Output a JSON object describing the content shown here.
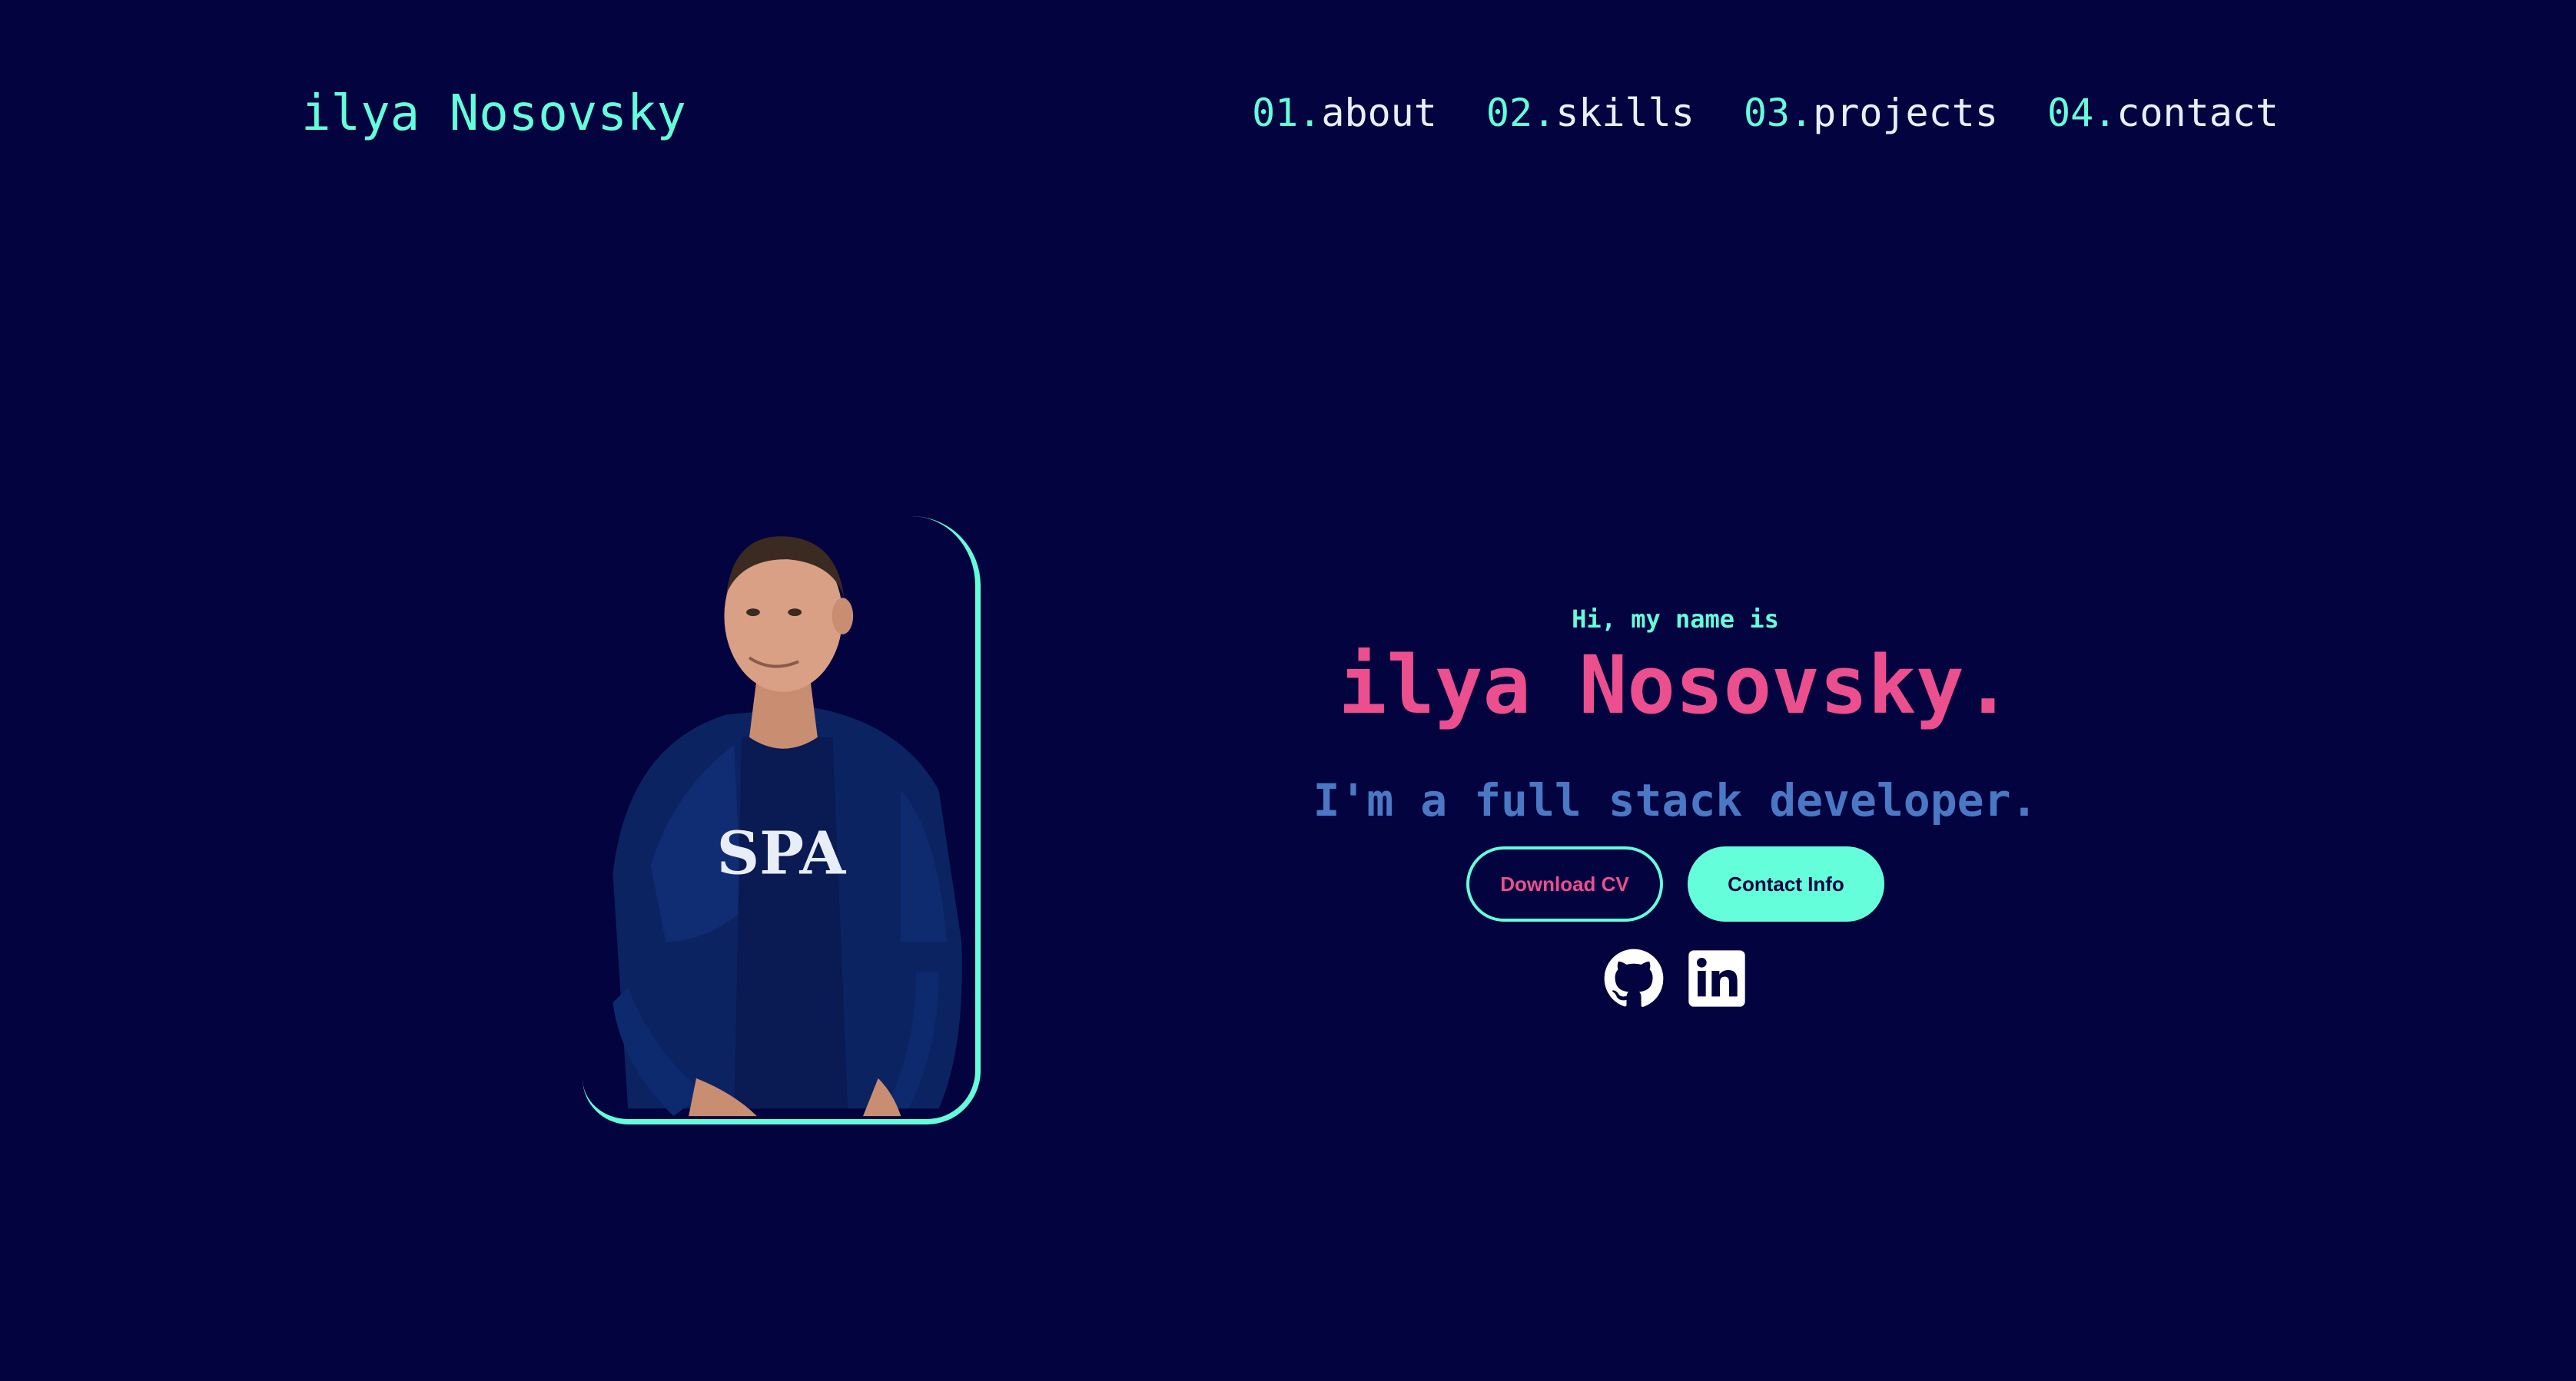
{
  "header": {
    "logo_text": "ilya Nosovsky",
    "nav": [
      {
        "number": "01.",
        "label": "about"
      },
      {
        "number": "02.",
        "label": "skills"
      },
      {
        "number": "03.",
        "label": "projects"
      },
      {
        "number": "04.",
        "label": "contact"
      }
    ]
  },
  "hero": {
    "greeting": "Hi, my name is",
    "name": "ilya Nosovsky.",
    "tagline": "I'm a full stack developer.",
    "buttons": {
      "download_cv": "Download CV",
      "contact_info": "Contact Info"
    },
    "socials": [
      {
        "icon": "github-icon"
      },
      {
        "icon": "linkedin-icon"
      }
    ],
    "photo_shirt_text": "SPA"
  },
  "colors": {
    "background": "#03033f",
    "accent": "#64ffda",
    "pink": "#ec4f8d",
    "blue": "#4a78c4",
    "nav_text": "#e6f1ff"
  }
}
